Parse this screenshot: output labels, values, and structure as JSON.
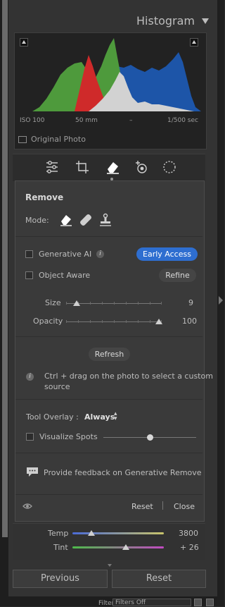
{
  "histogram": {
    "title": "Histogram",
    "iso": "ISO 100",
    "focal": "50 mm",
    "aperture": "–",
    "shutter": "1/500 sec",
    "original_photo_label": "Original Photo",
    "colors": {
      "red": "#cf2a2a",
      "green": "#4e9a3c",
      "blue": "#1d55a8",
      "luminance": "#d2d2d2"
    }
  },
  "tools": [
    "sliders-icon",
    "crop-icon",
    "eraser-icon",
    "red-eye-icon",
    "masking-icon"
  ],
  "remove": {
    "title": "Remove",
    "mode_label": "Mode:",
    "generative_ai_label": "Generative AI",
    "early_access_label": "Early Access",
    "object_aware_label": "Object Aware",
    "refine_label": "Refine",
    "size_label": "Size",
    "size_value": "9",
    "opacity_label": "Opacity",
    "opacity_value": "100",
    "refresh_label": "Refresh",
    "hint_line1": "Ctrl + drag on the photo to select a custom",
    "hint_line2": "source",
    "tool_overlay_label": "Tool Overlay :",
    "tool_overlay_value": "Always",
    "visualize_spots_label": "Visualize Spots",
    "feedback_label": "Provide feedback on Generative Remove",
    "reset_label": "Reset",
    "close_label": "Close",
    "accent": "#2e6ed0"
  },
  "white_balance": {
    "temp_label": "Temp",
    "temp_value": "3800",
    "tint_label": "Tint",
    "tint_value": "+ 26"
  },
  "buttons": {
    "previous_label": "Previous",
    "reset_label": "Reset"
  },
  "filmstrip": {
    "filter_label": "Filter :",
    "filter_value": "Filters Off"
  }
}
